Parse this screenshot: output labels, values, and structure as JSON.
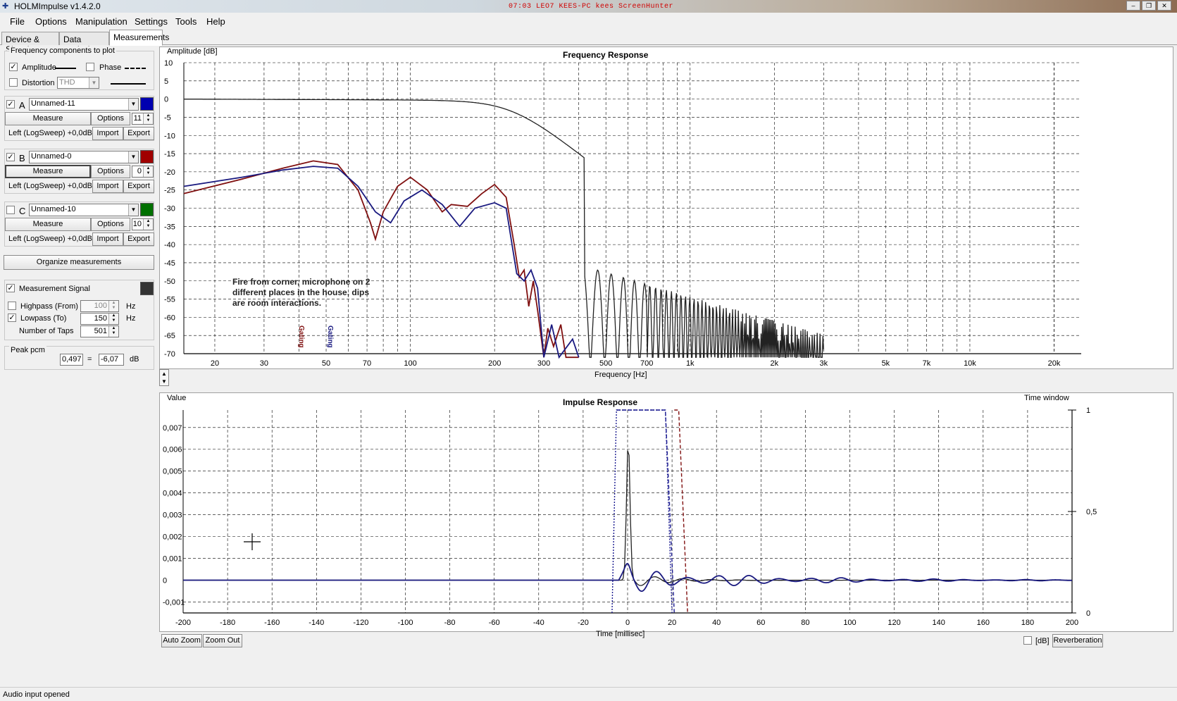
{
  "window": {
    "title": "HOLMImpulse  v1.4.2.0",
    "recorder_text": "07:03 LEO7 KEES-PC kees ScreenHunter",
    "buttons": [
      "‒",
      "❐",
      "✕"
    ]
  },
  "menu": [
    "File",
    "Options",
    "Manipulation",
    "Settings",
    "Tools",
    "Help"
  ],
  "tabs": [
    "Device & Signal",
    "Data analysis",
    "Measurements"
  ],
  "freq_components": {
    "title": "Frequency components to plot",
    "amplitude": "Amplitude",
    "phase": "Phase",
    "distortion": "Distortion",
    "distortion_select": "THD",
    "amplitude_checked": true,
    "phase_checked": false,
    "distortion_checked": false
  },
  "measurements": [
    {
      "letter": "A",
      "name": "Unnamed-11",
      "checked": true,
      "color": "#0000b0",
      "measure": "Measure",
      "options": "Options",
      "taps": "11",
      "channel": "Left (LogSweep) +0,0dB",
      "import": "Import",
      "export": "Export"
    },
    {
      "letter": "B",
      "name": "Unnamed-0",
      "checked": true,
      "color": "#a00000",
      "measure": "Measure",
      "options": "Options",
      "taps": "0",
      "channel": "Left (LogSweep) +0,0dB",
      "import": "Import",
      "export": "Export"
    },
    {
      "letter": "C",
      "name": "Unnamed-10",
      "checked": false,
      "color": "#007000",
      "measure": "Measure",
      "options": "Options",
      "taps": "10",
      "channel": "Left (LogSweep) +0,0dB",
      "import": "Import",
      "export": "Export"
    }
  ],
  "organize_label": "Organize measurements",
  "measurement_signal": {
    "label": "Measurement Signal",
    "checked": true,
    "color": "#333333",
    "highpass": "Highpass (From)",
    "highpass_val": "100",
    "highpass_checked": false,
    "lowpass": "Lowpass (To)",
    "lowpass_val": "150",
    "lowpass_checked": true,
    "hz": "Hz",
    "taps_label": "Number of Taps",
    "taps_val": "501"
  },
  "peak": {
    "label": "Peak pcm",
    "value": "0,497",
    "eq": "=",
    "db_value": "-6,07",
    "unit": "dB"
  },
  "freq_chart": {
    "title": "Frequency Response",
    "ylabel": "Amplitude [dB]",
    "xlabel": "Frequency [Hz]",
    "yticks": [
      "10",
      "5",
      "0",
      "-5",
      "-10",
      "-15",
      "-20",
      "-25",
      "-30",
      "-35",
      "-40",
      "-45",
      "-50",
      "-55",
      "-60",
      "-65",
      "-70"
    ],
    "xticks": [
      "20",
      "30",
      "50",
      "70",
      "100",
      "200",
      "300",
      "500",
      "700",
      "1k",
      "2k",
      "3k",
      "5k",
      "7k",
      "10k",
      "20k"
    ],
    "annotation": [
      "Fire from corner, microphone on 2",
      "different places in the house, dips",
      "are room interactions."
    ],
    "markers": [
      "Gating",
      "Gating"
    ],
    "colors": {
      "ref": "#222222",
      "a": "#1a1a80",
      "b": "#801010"
    }
  },
  "impulse_chart": {
    "title": "Impulse Response",
    "ylabel": "Value",
    "xlabel": "Time [millisec]",
    "time_window": "Time window",
    "yticks": [
      "0,007",
      "0,006",
      "0,005",
      "0,004",
      "0,003",
      "0,002",
      "0,001",
      "0",
      "-0,001"
    ],
    "xticks": [
      "-200",
      "-180",
      "-160",
      "-140",
      "-120",
      "-100",
      "-80",
      "-60",
      "-40",
      "-20",
      "0",
      "20",
      "40",
      "60",
      "80",
      "100",
      "120",
      "140",
      "160",
      "180",
      "200"
    ],
    "right_ticks": [
      "1",
      "0,5",
      "0"
    ]
  },
  "bottom": {
    "auto_zoom": "Auto Zoom",
    "zoom_out": "Zoom Out",
    "db": "[dB]",
    "reverb": "Reverberation"
  },
  "status": "Audio input opened"
}
